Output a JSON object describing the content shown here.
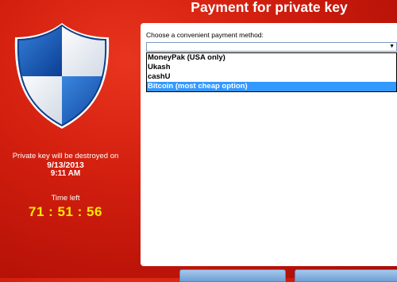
{
  "left_panel": {
    "destroy_label": "Private key will be destroyed on",
    "destroy_date": "9/13/2013",
    "destroy_time": "9:11 AM",
    "time_left_label": "Time left",
    "countdown": "71 : 51 : 56"
  },
  "page_title": "Payment for private key",
  "payment": {
    "label": "Choose a convenient payment method:",
    "selected_value": "",
    "options": [
      "MoneyPak (USA only)",
      "Ukash",
      "cashU",
      "Bitcoin (most cheap option)"
    ],
    "highlighted_option": "Bitcoin (most cheap option)"
  },
  "colors": {
    "background": "#c8180a",
    "countdown": "#ffe800",
    "shield_blue": "#1f66c4",
    "selection": "#3399ff"
  },
  "icons": {
    "logo": "shield-logo-icon",
    "dropdown": "chevron-down-icon"
  }
}
